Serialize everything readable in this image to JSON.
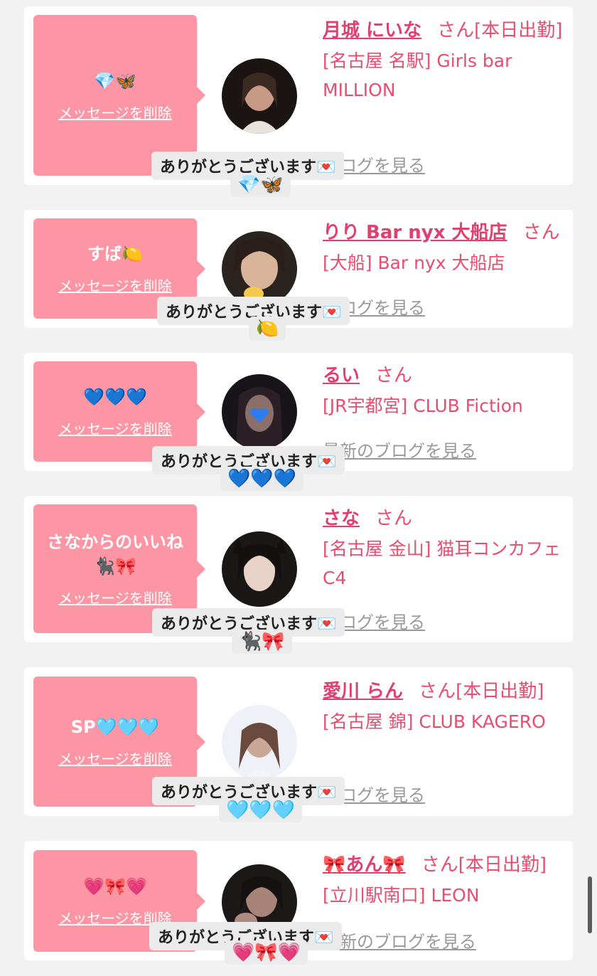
{
  "messages": [
    {
      "bubble_text": "💎🦋",
      "delete_label": "メッセージを削除",
      "name": "月城 にいな",
      "honorific": "さん",
      "status": "[本日出勤]",
      "shop": "[名古屋 名駅] Girls bar MILLION",
      "blog_label": "ブログを見る",
      "reply_text": "ありがとうございます💌",
      "reply_emoji": "💎🦋",
      "avatar_colors": [
        "#1a1512",
        "#c89a86"
      ]
    },
    {
      "bubble_text": "すば🍋",
      "delete_label": "メッセージを削除",
      "name": "りり Bar nyx 大船店",
      "honorific": "さん",
      "status": "",
      "shop": "[大船] Bar nyx 大船店",
      "blog_label": "ブログを見る",
      "reply_text": "ありがとうございます💌",
      "reply_emoji": "🍋",
      "avatar_colors": [
        "#2b2320",
        "#d8b49a"
      ]
    },
    {
      "bubble_text": "💙💙💙",
      "delete_label": "メッセージを削除",
      "name": "るい",
      "honorific": "さん",
      "status": "",
      "shop": "[JR宇都宮] CLUB Fiction",
      "blog_label": "最新のブログを見る",
      "reply_text": "ありがとうございます💌",
      "reply_emoji": "💙💙💙",
      "avatar_colors": [
        "#17141a",
        "#8a6f6a"
      ]
    },
    {
      "bubble_text": "さなからのいいね🐈‍⬛🎀",
      "delete_label": "メッセージを削除",
      "name": "さな",
      "honorific": "さん",
      "status": "",
      "shop": "[名古屋 金山] 猫耳コンカフェ C4",
      "blog_label": "ブログを見る",
      "reply_text": "ありがとうございます💌",
      "reply_emoji": "🐈‍⬛🎀",
      "avatar_colors": [
        "#1b1717",
        "#e9d2c8"
      ]
    },
    {
      "bubble_text": "SP🩵🩵🩵",
      "delete_label": "メッセージを削除",
      "name": "愛川 らん",
      "honorific": "さん",
      "status": "[本日出勤]",
      "shop": "[名古屋 錦] CLUB KAGERO",
      "blog_label": "ブログを見る",
      "reply_text": "ありがとうございます💌",
      "reply_emoji": "🩵🩵🩵",
      "avatar_colors": [
        "#eef1f8",
        "#caa898"
      ]
    },
    {
      "bubble_text": "💗🎀💗",
      "delete_label": "メッセージを削除",
      "name": "🎀あん🎀",
      "honorific": "さん",
      "status": "[本日出勤]",
      "shop": "[立川駅南口] LEON",
      "blog_label": "最新のブログを見る",
      "reply_text": "ありがとうございます💌",
      "reply_emoji": "💗🎀💗",
      "avatar_colors": [
        "#1c1818",
        "#a88478"
      ]
    }
  ],
  "colors": {
    "accent": "#e04070",
    "bubble": "#fd96a4",
    "background": "#f2f2f2"
  }
}
